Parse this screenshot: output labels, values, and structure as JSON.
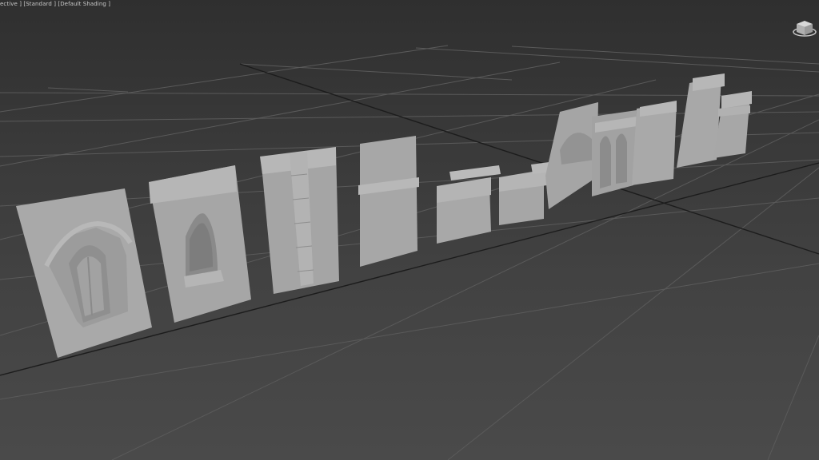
{
  "viewport": {
    "labels": [
      "ective ]",
      "[Standard ]",
      "[Default Shading ]"
    ]
  },
  "viewcube": {
    "icon": "viewcube-icon"
  },
  "colors": {
    "background_top": "#2f2f2f",
    "background_bottom": "#4a4a4a",
    "grid_line": "#5a5a5a",
    "grid_axis": "#1e1e1e",
    "mesh_face": "#a8a8a8",
    "mesh_shade": "#8e8e8e",
    "label_text": "#c9c9c9"
  }
}
